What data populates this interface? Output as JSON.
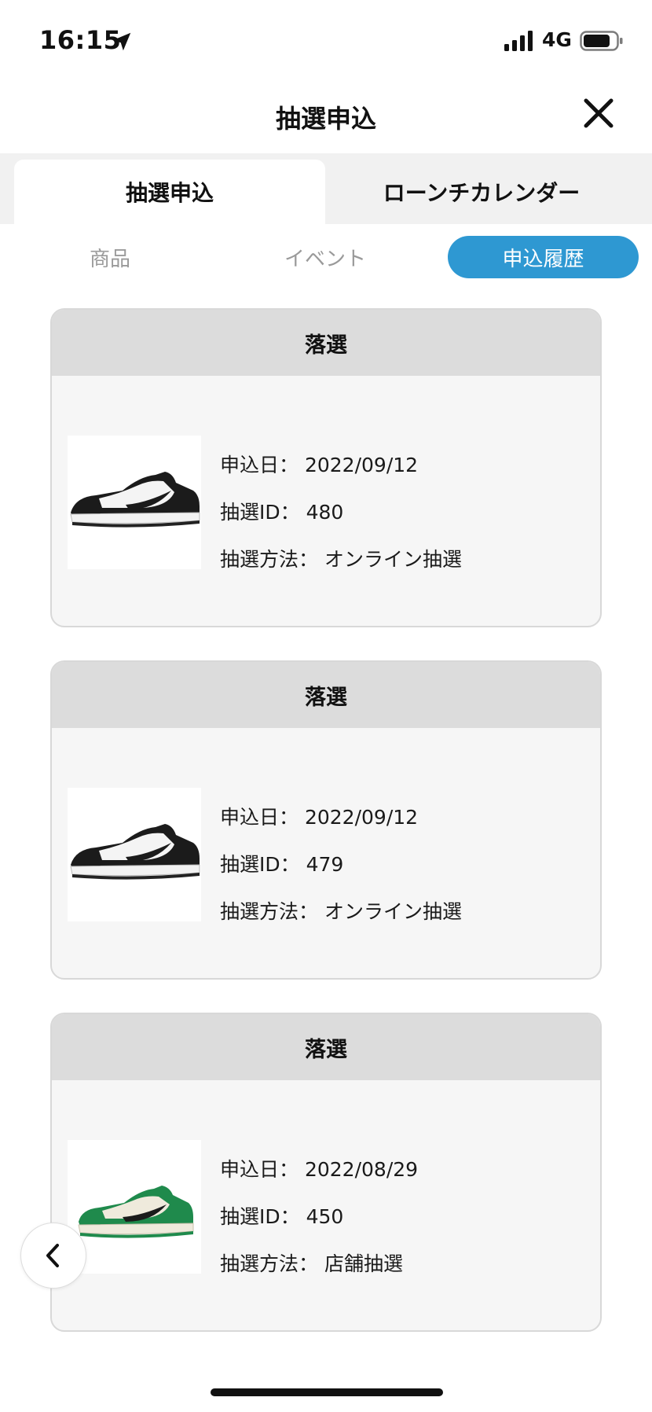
{
  "status_bar": {
    "time": "16:15",
    "network": "4G",
    "icons": [
      "location-arrow-icon",
      "cellular-signal-icon",
      "battery-icon"
    ]
  },
  "header": {
    "title": "抽選申込",
    "close_icon": "close-icon"
  },
  "tabs": [
    {
      "label": "抽選申込",
      "active": true
    },
    {
      "label": "ローンチカレンダー",
      "active": false
    }
  ],
  "subtabs": [
    {
      "label": "商品",
      "active": false
    },
    {
      "label": "イベント",
      "active": false
    },
    {
      "label": "申込履歴",
      "active": true
    }
  ],
  "cards": [
    {
      "status": "落選",
      "date_label": "申込日：",
      "date": "2022/09/12",
      "id_label": "抽選ID：",
      "id": "480",
      "method_label": "抽選方法：",
      "method": "オンライン抽選",
      "shoe_colorway": "black-white"
    },
    {
      "status": "落選",
      "date_label": "申込日：",
      "date": "2022/09/12",
      "id_label": "抽選ID：",
      "id": "479",
      "method_label": "抽選方法：",
      "method": "オンライン抽選",
      "shoe_colorway": "black-white"
    },
    {
      "status": "落選",
      "date_label": "申込日：",
      "date": "2022/08/29",
      "id_label": "抽選ID：",
      "id": "450",
      "method_label": "抽選方法：",
      "method": "店舗抽選",
      "shoe_colorway": "green-white"
    }
  ],
  "colors": {
    "accent": "#2e98d2",
    "card_header": "#dcdcdc",
    "card_body": "#f6f6f6"
  },
  "back_icon": "chevron-left-icon"
}
